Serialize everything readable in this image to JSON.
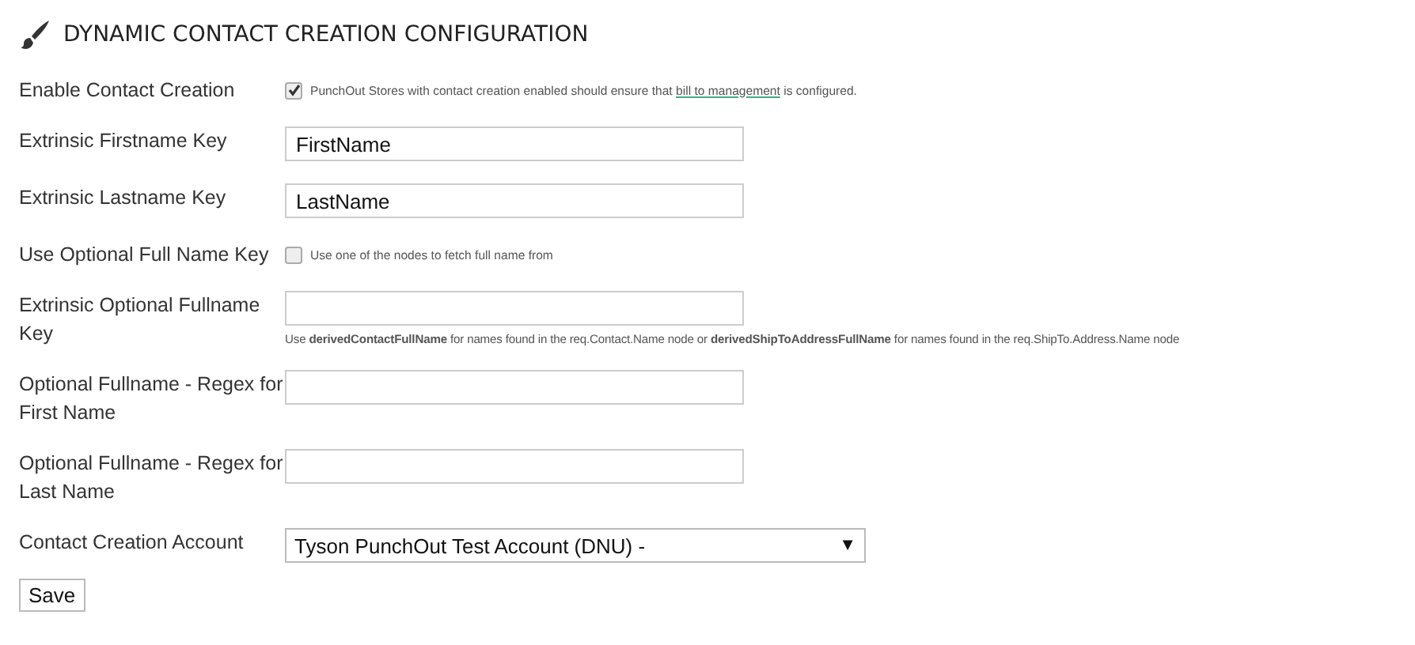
{
  "title": "DYNAMIC CONTACT CREATION CONFIGURATION",
  "fields": [
    {
      "kind": "checkbox",
      "label": "Enable Contact Creation",
      "checked": true,
      "note": {
        "before": "PunchOut Stores with contact creation enabled should ensure that ",
        "link": "bill to management",
        "after": " is configured."
      }
    },
    {
      "kind": "text",
      "label": "Extrinsic Firstname Key",
      "value": "FirstName"
    },
    {
      "kind": "text",
      "label": "Extrinsic Lastname Key",
      "value": "LastName"
    },
    {
      "kind": "checkbox",
      "label": "Use Optional Full Name Key",
      "checked": false,
      "note": {
        "before": "Use one of the nodes to fetch full name from"
      }
    },
    {
      "kind": "text",
      "label": "Extrinsic Optional Fullname Key",
      "hint": "Use **derivedContactFullName** for names found in the req.Contact.Name node or **derivedShipToAddressFullName** for names found in the req.ShipTo.Address.Name node"
    },
    {
      "kind": "text",
      "label": "Optional Fullname - Regex for First Name"
    },
    {
      "kind": "text",
      "label": "Optional Fullname - Regex for Last Name"
    },
    {
      "kind": "select",
      "label": "Contact Creation Account",
      "value": "Tyson PunchOut Test Account (DNU) -",
      "arrow": "▼"
    }
  ],
  "buttons": [
    "Save"
  ]
}
